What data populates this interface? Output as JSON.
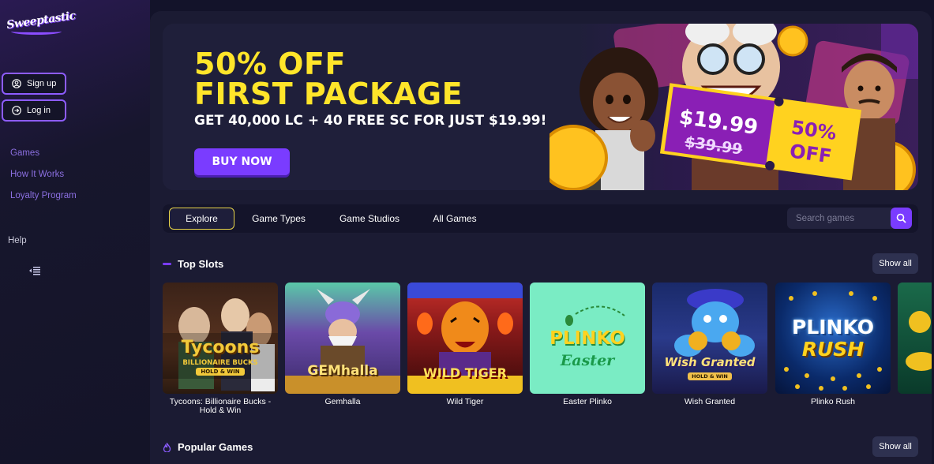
{
  "brand": {
    "logo_text": "Sweeptastic"
  },
  "sidebar": {
    "signup_label": "Sign up",
    "login_label": "Log in",
    "nav": [
      {
        "label": "Games"
      },
      {
        "label": "How It Works"
      },
      {
        "label": "Loyalty Program"
      }
    ],
    "help_label": "Help"
  },
  "hero": {
    "title_line1": "50% OFF",
    "title_line2": "FIRST PACKAGE",
    "subtitle": "GET 40,000 LC + 40 FREE SC FOR JUST $19.99!",
    "cta_label": "BUY NOW",
    "ticket_price": "$19.99",
    "ticket_old_price": "$39.99",
    "ticket_discount_line1": "50%",
    "ticket_discount_line2": "OFF",
    "colors": {
      "title": "#ffe52a",
      "cta": "#7a3cff",
      "ticket": "#8a1fb5",
      "ticket_gold": "#ffd21f"
    }
  },
  "tabs": [
    {
      "label": "Explore",
      "active": true
    },
    {
      "label": "Game Types",
      "active": false
    },
    {
      "label": "Game Studios",
      "active": false
    },
    {
      "label": "All Games",
      "active": false
    }
  ],
  "search": {
    "placeholder": "Search games",
    "icon": "search-icon"
  },
  "top_slots": {
    "title": "Top Slots",
    "show_all_label": "Show all",
    "games": [
      {
        "name": "Tycoons: Billionaire Bucks - Hold & Win",
        "art_line1": "Tycoons",
        "art_line2": "BILLIONAIRE BUCKS",
        "art_line3": "HOLD & WIN"
      },
      {
        "name": "Gemhalla",
        "art_line1": "GEMhalla"
      },
      {
        "name": "Wild Tiger",
        "art_line1": "WILD TIGER"
      },
      {
        "name": "Easter Plinko",
        "art_line1": "PLINKO",
        "art_line2": "Easter"
      },
      {
        "name": "Wish Granted",
        "art_line1": "Wish Granted",
        "art_line2": "HOLD & WIN"
      },
      {
        "name": "Plinko Rush",
        "art_line1": "PLINKO",
        "art_line2": "RUSH"
      }
    ]
  },
  "popular_games": {
    "title": "Popular Games",
    "show_all_label": "Show all"
  }
}
